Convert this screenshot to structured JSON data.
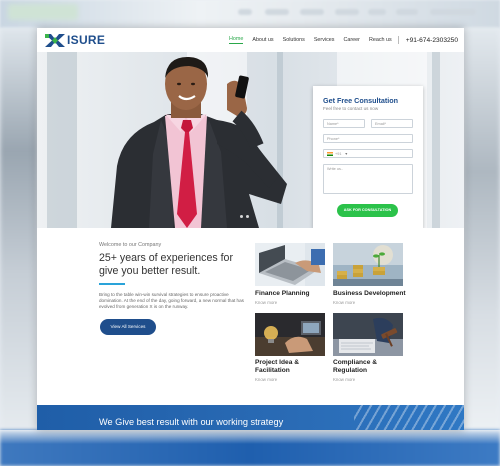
{
  "brand": {
    "name": "ISURE"
  },
  "nav": {
    "items": [
      "Home",
      "About us",
      "Solutions",
      "Services",
      "Career",
      "Reach us"
    ],
    "active": "Home",
    "phone": "+91-674-2303250"
  },
  "form": {
    "title": "Get Free Consultation",
    "subtitle": "Feel free to contact us now",
    "name_placeholder": "Name*",
    "email_placeholder": "Email*",
    "phone_placeholder": "Phone*",
    "country_code": "+91",
    "message_placeholder": "Write us..",
    "submit_label": "ASK FOR CONSULTATION"
  },
  "about": {
    "welcome": "Welcome to our Company",
    "headline": "25+ years of experiences for give you better result.",
    "paragraph": "Bring to the table win-win survival strategies to ensure proactive domination. At the end of the day, going forward, a new normal that has evolved from generation X is on the runway.",
    "button_label": "View All Services"
  },
  "services": [
    {
      "title": "Finance Planning",
      "link": "Know more"
    },
    {
      "title": "Business Development",
      "link": "Know more"
    },
    {
      "title": "Project Idea & Facilitation",
      "link": "Know more"
    },
    {
      "title": "Compliance & Regulation",
      "link": "Know more"
    }
  ],
  "banner": {
    "text": "We Give best result with our working strategy"
  },
  "colors": {
    "brand_blue": "#1f4e8c",
    "accent_green": "#2bc24a",
    "nav_active": "#2aa84a"
  }
}
